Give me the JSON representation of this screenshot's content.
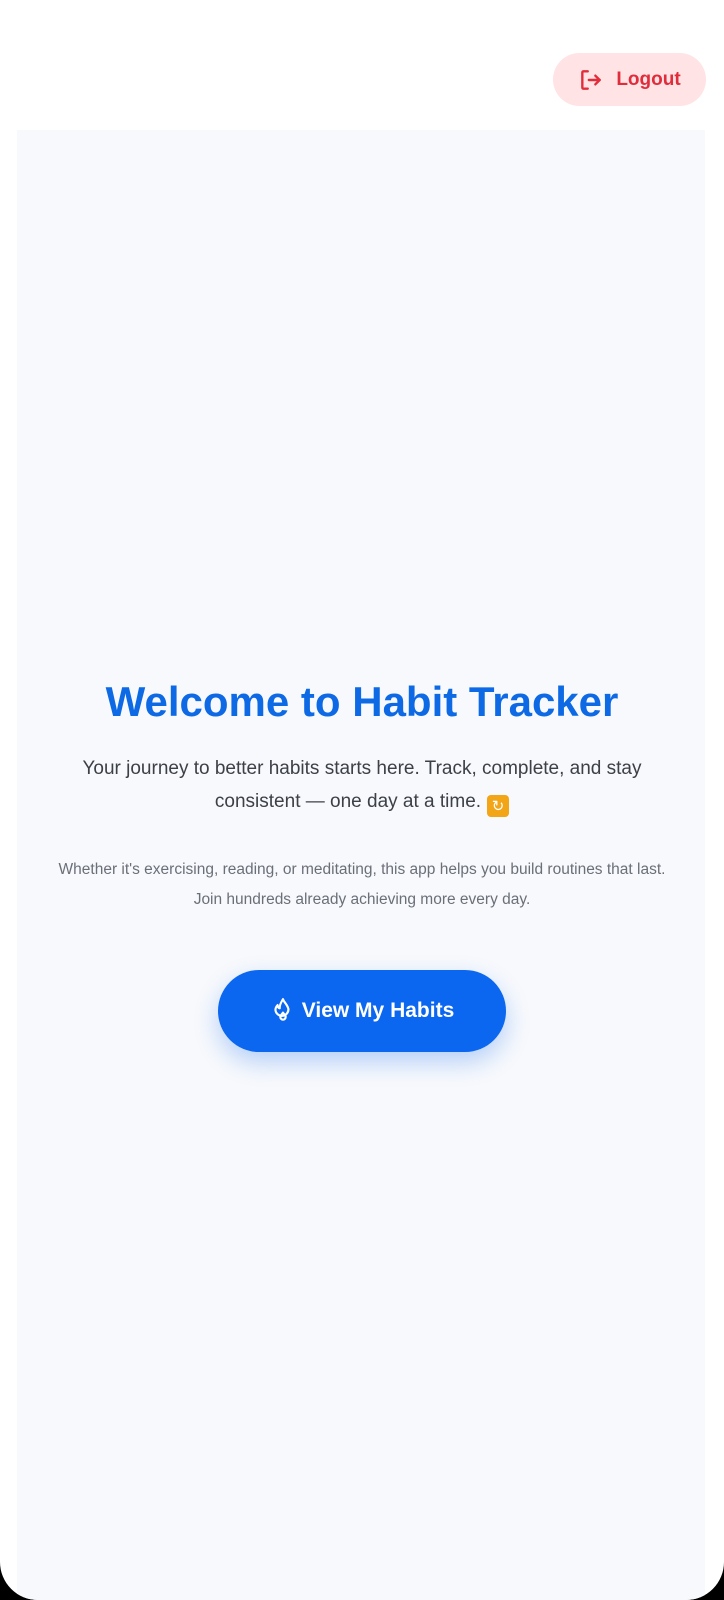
{
  "header": {
    "logout_label": "Logout",
    "logout_icon": "logout-icon",
    "logout_color": "#e02d3c",
    "logout_bg": "#ffe3e5"
  },
  "hero": {
    "title": "Welcome to Habit Tracker",
    "subtitle": "Your journey to better habits starts here. Track, complete, and stay consistent — one day at a time.",
    "subtitle_emoji": "repeat-emoji",
    "description": "Whether it's exercising, reading, or meditating, this app helps you build routines that last. Join hundreds already achieving more every day.",
    "cta_label": "View My Habits",
    "cta_icon": "flame-icon",
    "accent_color": "#0b66f0",
    "title_color": "#0d6ae4"
  }
}
